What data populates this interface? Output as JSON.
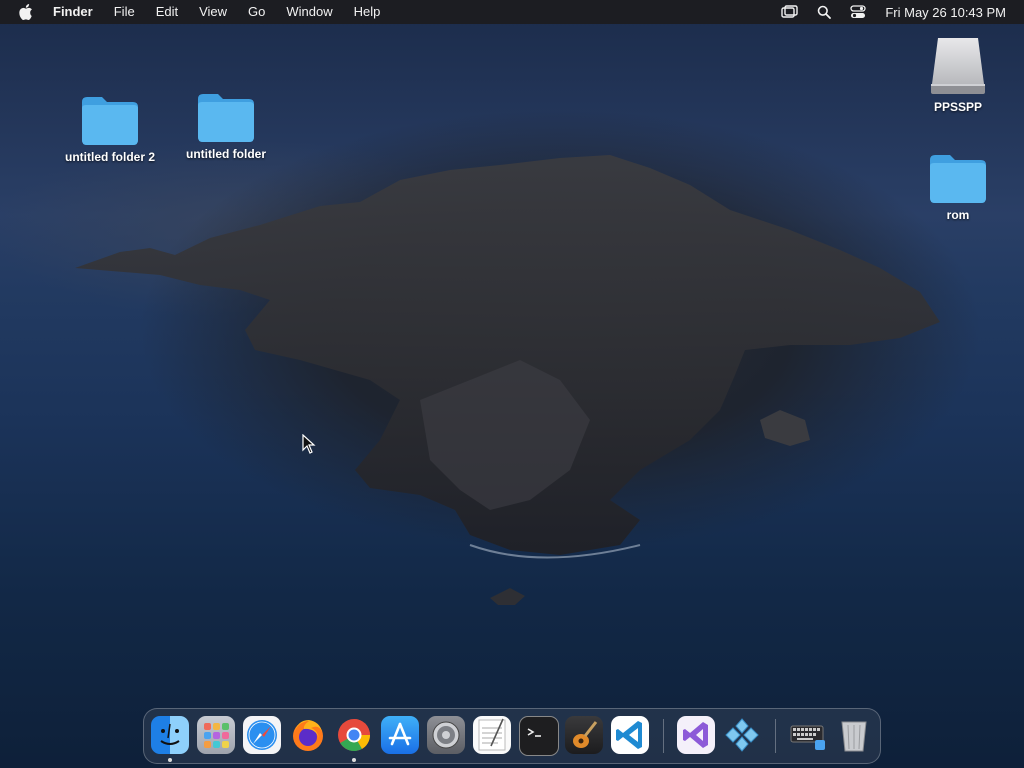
{
  "menubar": {
    "items": [
      "Finder",
      "File",
      "Edit",
      "View",
      "Go",
      "Window",
      "Help"
    ],
    "clock": "Fri May 26  10:43 PM",
    "status_icons": [
      "screen-mirroring-icon",
      "spotlight-search-icon",
      "control-center-icon"
    ]
  },
  "desktop": {
    "icons": [
      {
        "label": "untitled folder 2",
        "icon": "folder-icon"
      },
      {
        "label": "untitled folder",
        "icon": "folder-icon"
      },
      {
        "label": "PPSSPP",
        "icon": "disk-drive-icon"
      },
      {
        "label": "rom",
        "icon": "folder-icon"
      }
    ]
  },
  "dock": {
    "apps": [
      "finder-icon",
      "launchpad-icon",
      "safari-icon",
      "firefox-icon",
      "chrome-icon",
      "app-store-icon",
      "system-preferences-icon",
      "textedit-icon",
      "terminal-icon",
      "garageband-icon",
      "vscode-icon",
      "visual-studio-icon",
      "ppsspp-icon",
      "keyboard-viewer-icon",
      "trash-icon"
    ]
  },
  "colors": {
    "folder": "#5ab8f0",
    "menubar": "#1c1c1e"
  }
}
